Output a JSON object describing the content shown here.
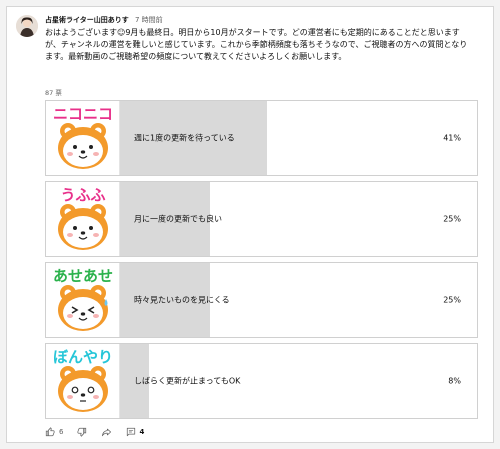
{
  "post": {
    "channel": "占星術ライター山田ありす",
    "time": "7 時間前",
    "text": "おはようございます☺9月も最終日。明日から10月がスタートです。どの運営者にも定期的にあることだと思いますが、チャンネルの運営を難しいと感じています。これから季節柄頻度も落ちそうなので、ご視聴者の方への質問となります。最新動画のご視聴希望の頻度について教えてくださいよろしくお願いします。",
    "votes": "87 票"
  },
  "poll": {
    "options": [
      {
        "label": "週に1度の更新を待っている",
        "percent_text": "41%",
        "fraction": 0.41,
        "thumb_caption": "ニコニコ",
        "thumb_color": "#e8308a",
        "mood": "smile"
      },
      {
        "label": "月に一度の更新でも良い",
        "percent_text": "25%",
        "fraction": 0.25,
        "thumb_caption": "うふふ",
        "thumb_color": "#e8308a",
        "mood": "smile"
      },
      {
        "label": "時々見たいものを見にくる",
        "percent_text": "25%",
        "fraction": 0.25,
        "thumb_caption": "あせあせ",
        "thumb_color": "#2bb24c",
        "mood": "sweat"
      },
      {
        "label": "しばらく更新が止まってもOK",
        "percent_text": "8%",
        "fraction": 0.08,
        "thumb_caption": "ぼんやり",
        "thumb_color": "#26c6d8",
        "mood": "dazed"
      }
    ]
  },
  "actions": {
    "like_count": "6",
    "reply_count": "4"
  },
  "colors": {
    "bar": "#d9d9d9",
    "bear_orange": "#f39a2b",
    "bear_face": "#ffffff"
  },
  "icons": [
    "thumbs-up-icon",
    "thumbs-down-icon",
    "share-icon",
    "comment-icon"
  ]
}
